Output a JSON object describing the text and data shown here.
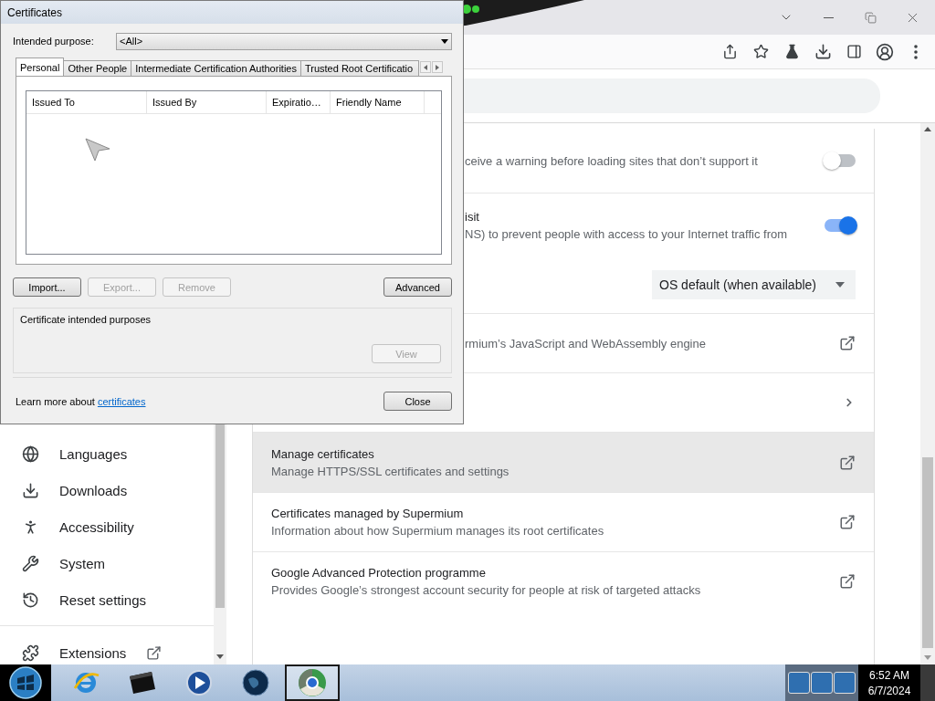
{
  "dialog": {
    "title": "Certificates",
    "purpose_label": "Intended purpose:",
    "purpose_value": "<All>",
    "tabs": [
      {
        "label": "Personal",
        "selected": true
      },
      {
        "label": "Other People",
        "selected": false
      },
      {
        "label": "Intermediate Certification Authorities",
        "selected": false
      },
      {
        "label": "Trusted Root Certificatio",
        "selected": false
      }
    ],
    "columns": [
      "Issued To",
      "Issued By",
      "Expiratio…",
      "Friendly Name"
    ],
    "buttons": [
      {
        "label": "Import...",
        "disabled": false
      },
      {
        "label": "Export...",
        "disabled": true
      },
      {
        "label": "Remove",
        "disabled": true
      },
      {
        "label": "Advanced",
        "disabled": false
      }
    ],
    "purposes_group": {
      "label": "Certificate intended purposes",
      "view_button": {
        "label": "View",
        "disabled": true
      }
    },
    "learn_more": {
      "text": "Learn more about",
      "link": "certificates"
    },
    "close_button": "Close"
  },
  "sidebar": {
    "items": [
      {
        "label": "Languages",
        "kind": "page"
      },
      {
        "label": "Downloads",
        "kind": "page"
      },
      {
        "label": "Accessibility",
        "kind": "page"
      },
      {
        "label": "System",
        "kind": "page"
      },
      {
        "label": "Reset settings",
        "kind": "page"
      },
      {
        "label": "Extensions",
        "kind": "external"
      }
    ]
  },
  "settings_rows": [
    {
      "kind": "toggle",
      "description": "ceive a warning before loading sites that don’t support it",
      "on": false,
      "highlighted": false
    },
    {
      "kind": "toggle",
      "title": "isit",
      "description": "NS) to prevent people with access to your Internet traffic from",
      "on": true,
      "highlighted": false
    },
    {
      "kind": "select",
      "value": "OS default (when available)",
      "highlighted": false
    },
    {
      "kind": "external",
      "description": "rmium’s JavaScript and WebAssembly engine",
      "highlighted": false
    },
    {
      "kind": "submenu",
      "highlighted": false
    },
    {
      "kind": "external",
      "title": "Manage certificates",
      "description": "Manage HTTPS/SSL certificates and settings",
      "highlighted": true
    },
    {
      "kind": "external",
      "title": "Certificates managed by Supermium",
      "description": "Information about how Supermium manages its root certificates",
      "highlighted": false
    },
    {
      "kind": "external",
      "title": "Google Advanced Protection programme",
      "description": "Provides Google’s strongest account security for people at risk of targeted attacks",
      "highlighted": false
    }
  ],
  "taskbar": {
    "apps": [
      {
        "selected": false
      },
      {
        "selected": false
      },
      {
        "selected": false
      },
      {
        "selected": false
      },
      {
        "selected": true
      }
    ],
    "clock": {
      "time": "6:52 AM",
      "date": "6/7/2024"
    }
  }
}
